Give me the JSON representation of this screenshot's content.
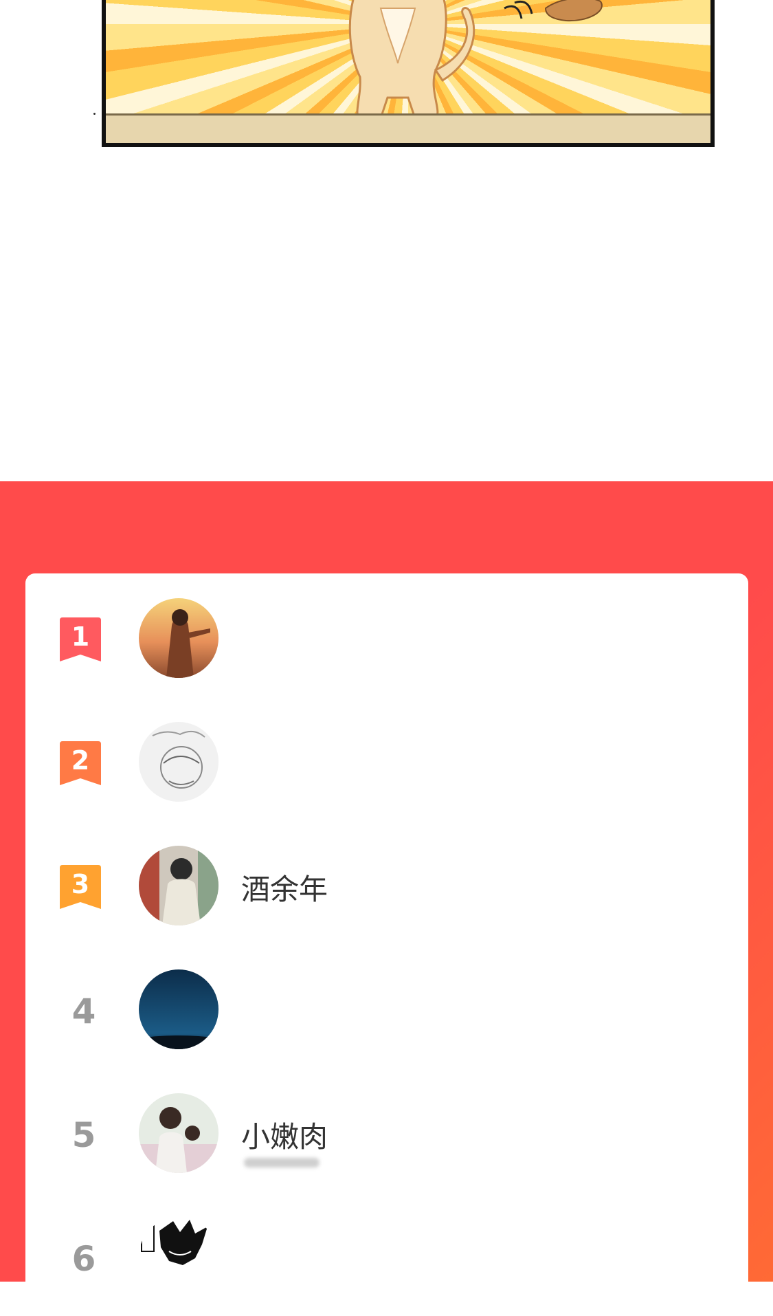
{
  "comic": {
    "description_icon": "comic-cat-panel"
  },
  "ranking": {
    "entries": [
      {
        "rank": "1",
        "name": "",
        "badge_color": "#ff5a5f",
        "avatar": "sunset-boy-avatar"
      },
      {
        "rank": "2",
        "name": "",
        "badge_color": "#ff7a45",
        "avatar": "sketch-avatar"
      },
      {
        "rank": "3",
        "name": "酒余年",
        "badge_color": "#ffa230",
        "avatar": "boy-avatar"
      },
      {
        "rank": "4",
        "name": "",
        "badge_color": "",
        "avatar": "night-sky-avatar"
      },
      {
        "rank": "5",
        "name": "小嫩肉",
        "badge_color": "",
        "avatar": "couple-avatar"
      },
      {
        "rank": "6",
        "name": "",
        "badge_color": "",
        "avatar": "manga-avatar"
      }
    ]
  },
  "colors": {
    "section_bg": "#ff4b4b",
    "rank_gray": "#9a9a9a"
  }
}
